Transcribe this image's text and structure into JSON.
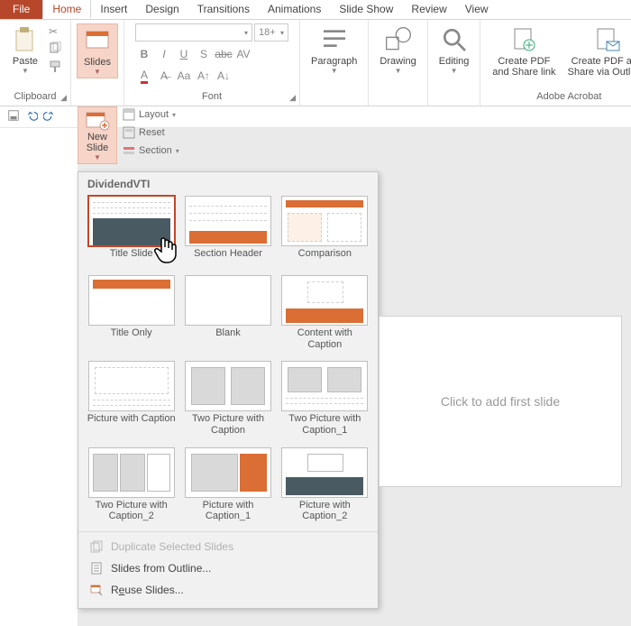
{
  "tabs": {
    "file": "File",
    "home": "Home",
    "insert": "Insert",
    "design": "Design",
    "transitions": "Transitions",
    "animations": "Animations",
    "slideshow": "Slide Show",
    "review": "Review",
    "view": "View"
  },
  "ribbon": {
    "clipboard": {
      "paste": "Paste",
      "label": "Clipboard"
    },
    "slides": {
      "btn": "Slides",
      "label": ""
    },
    "font": {
      "label": "Font",
      "size": "18+"
    },
    "paragraph": {
      "btn": "Paragraph"
    },
    "drawing": {
      "btn": "Drawing"
    },
    "editing": {
      "btn": "Editing"
    },
    "acrobat": {
      "share": "Create PDF and Share link",
      "outlook": "Create PDF and Share via Outlook",
      "label": "Adobe Acrobat"
    }
  },
  "newslide": {
    "btn": "New Slide",
    "layout": "Layout",
    "reset": "Reset",
    "section": "Section"
  },
  "gallery": {
    "title": "DividendVTI",
    "items": [
      "Title Slide",
      "Section Header",
      "Comparison",
      "Title Only",
      "Blank",
      "Content with Caption",
      "Picture with Caption",
      "Two Picture with Caption",
      "Two Picture with Caption_1",
      "Two Picture with Caption_2",
      "Picture with Caption_1",
      "Picture with Caption_2"
    ],
    "duplicate": "Duplicate Selected Slides",
    "outline": "Slides from Outline...",
    "reuse_pre": "R",
    "reuse_u": "e",
    "reuse_post": "use Slides..."
  },
  "stage": {
    "placeholder": "Click to add first slide"
  }
}
